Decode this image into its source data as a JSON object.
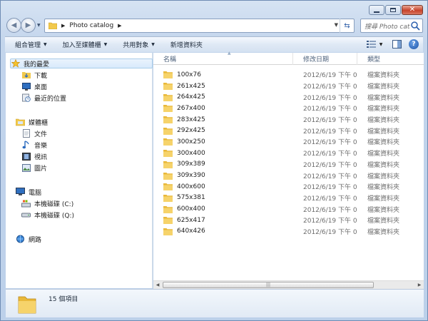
{
  "address": {
    "path_label": "Photo catalog",
    "search_placeholder": "搜尋 Photo catalog"
  },
  "toolbar": {
    "organize": "組合管理",
    "include_library": "加入至媒體櫃",
    "share_with": "共用對象",
    "new_folder": "新增資料夾"
  },
  "nav": {
    "favorites": "我的最愛",
    "downloads": "下載",
    "desktop": "桌面",
    "recent": "最近的位置",
    "libraries": "媒體櫃",
    "documents": "文件",
    "music": "音樂",
    "videos": "視訊",
    "pictures": "圖片",
    "computer": "電腦",
    "drive_c": "本機磁碟 (C:)",
    "drive_q": "本機磁碟 (Q:)",
    "network": "網路"
  },
  "columns": {
    "name": "名稱",
    "date": "修改日期",
    "type": "類型"
  },
  "files": [
    {
      "name": "100x76",
      "date": "2012/6/19 下午 0...",
      "type": "檔案資料夾"
    },
    {
      "name": "261x425",
      "date": "2012/6/19 下午 0...",
      "type": "檔案資料夾"
    },
    {
      "name": "264x425",
      "date": "2012/6/19 下午 0...",
      "type": "檔案資料夾"
    },
    {
      "name": "267x400",
      "date": "2012/6/19 下午 0...",
      "type": "檔案資料夾"
    },
    {
      "name": "283x425",
      "date": "2012/6/19 下午 0...",
      "type": "檔案資料夾"
    },
    {
      "name": "292x425",
      "date": "2012/6/19 下午 0...",
      "type": "檔案資料夾"
    },
    {
      "name": "300x250",
      "date": "2012/6/19 下午 0...",
      "type": "檔案資料夾"
    },
    {
      "name": "300x400",
      "date": "2012/6/19 下午 0...",
      "type": "檔案資料夾"
    },
    {
      "name": "309x389",
      "date": "2012/6/19 下午 0...",
      "type": "檔案資料夾"
    },
    {
      "name": "309x390",
      "date": "2012/6/19 下午 0...",
      "type": "檔案資料夾"
    },
    {
      "name": "400x600",
      "date": "2012/6/19 下午 0...",
      "type": "檔案資料夾"
    },
    {
      "name": "575x381",
      "date": "2012/6/19 下午 0...",
      "type": "檔案資料夾"
    },
    {
      "name": "600x400",
      "date": "2012/6/19 下午 0...",
      "type": "檔案資料夾"
    },
    {
      "name": "625x417",
      "date": "2012/6/19 下午 0...",
      "type": "檔案資料夾"
    },
    {
      "name": "640x426",
      "date": "2012/6/19 下午 0...",
      "type": "檔案資料夾"
    }
  ],
  "status": {
    "item_count": "15 個項目"
  },
  "colors": {
    "folder_yellow": "#f2c94c",
    "chrome_blue": "#c3d5ec"
  },
  "icons": [
    "back-arrow-icon",
    "forward-arrow-icon",
    "folder-icon",
    "refresh-icon",
    "search-icon",
    "views-icon",
    "preview-pane-icon",
    "help-icon",
    "star-icon",
    "download-icon",
    "desktop-icon",
    "recent-places-icon",
    "library-icon",
    "document-icon",
    "music-icon",
    "video-icon",
    "picture-icon",
    "computer-icon",
    "drive-icon",
    "network-icon"
  ]
}
